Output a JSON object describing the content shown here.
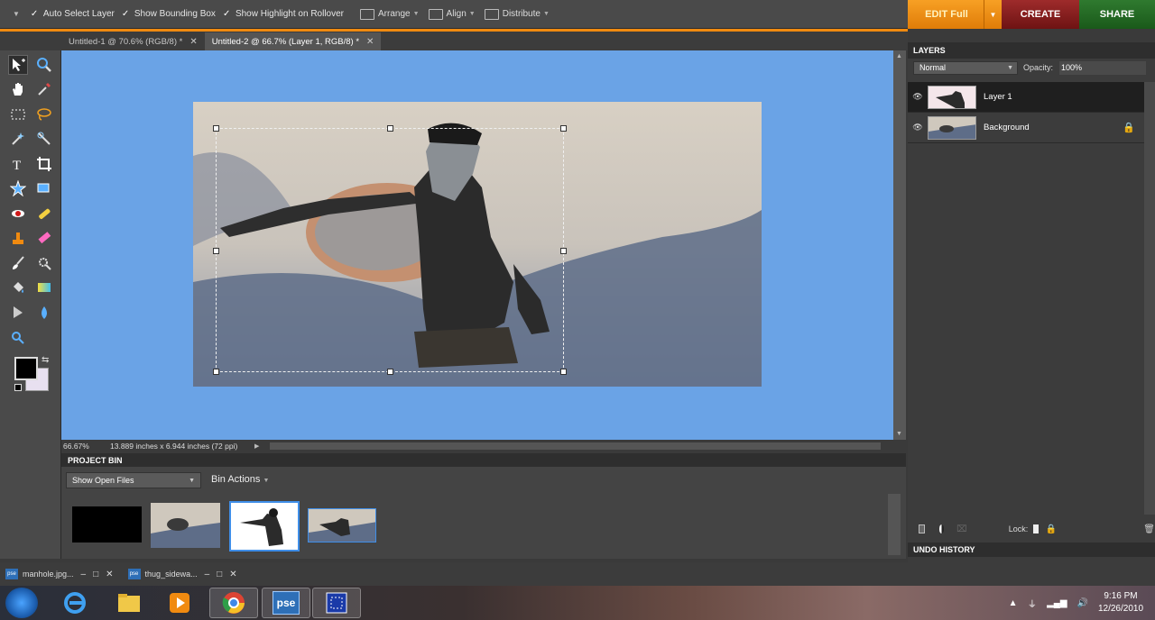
{
  "options_bar": {
    "auto_select_layer": "Auto Select Layer",
    "show_bounding_box": "Show Bounding Box",
    "show_highlight": "Show Highlight on Rollover",
    "arrange": "Arrange",
    "align": "Align",
    "distribute": "Distribute"
  },
  "modes": {
    "edit_full": "EDIT Full",
    "create": "CREATE",
    "share": "SHARE"
  },
  "doc_tabs": [
    {
      "label": "Untitled-1 @ 70.6% (RGB/8) *"
    },
    {
      "label": "Untitled-2 @ 66.7% (Layer 1, RGB/8) *"
    }
  ],
  "status": {
    "zoom": "66.67%",
    "doc_info": "13.889 inches x 6.944 inches (72 ppi)"
  },
  "project_bin": {
    "title": "PROJECT BIN",
    "show_select": "Show Open Files",
    "bin_actions": "Bin Actions"
  },
  "open_files": [
    {
      "label": "manhole.jpg..."
    },
    {
      "label": "thug_sidewa..."
    }
  ],
  "layers": {
    "title": "LAYERS",
    "blend_mode": "Normal",
    "opacity_label": "Opacity:",
    "opacity_value": "100%",
    "items": [
      {
        "name": "Layer 1"
      },
      {
        "name": "Background"
      }
    ],
    "lock_label": "Lock:"
  },
  "undo_history": {
    "title": "UNDO HISTORY"
  },
  "taskbar": {
    "time": "9:16 PM",
    "date": "12/26/2010",
    "pse_label": "pse"
  },
  "colors": {
    "canvas_bg": "#6aa3e6",
    "edit_full": "#f08a10",
    "create": "#8a1f1f",
    "share": "#256b25"
  }
}
